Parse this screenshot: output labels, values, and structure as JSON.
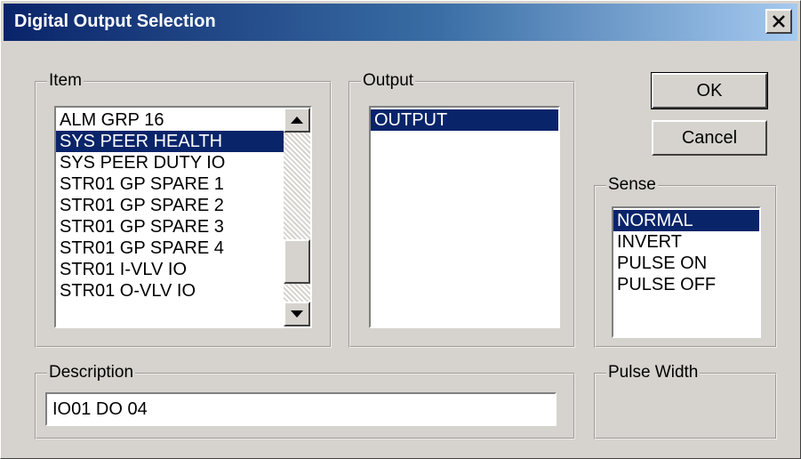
{
  "window": {
    "title": "Digital Output Selection",
    "close_glyph": "✕"
  },
  "item_group": {
    "label": "Item",
    "items": [
      {
        "label": "ALM GRP 16",
        "selected": false
      },
      {
        "label": "SYS PEER HEALTH",
        "selected": true
      },
      {
        "label": "SYS PEER DUTY IO",
        "selected": false
      },
      {
        "label": "STR01 GP SPARE 1",
        "selected": false
      },
      {
        "label": "STR01 GP SPARE 2",
        "selected": false
      },
      {
        "label": "STR01 GP SPARE 3",
        "selected": false
      },
      {
        "label": "STR01 GP SPARE 4",
        "selected": false
      },
      {
        "label": "STR01 I-VLV IO",
        "selected": false
      },
      {
        "label": "STR01 O-VLV IO",
        "selected": false
      }
    ],
    "scroll_up_icon": "scroll-up-arrow",
    "scroll_down_icon": "scroll-down-arrow"
  },
  "output_group": {
    "label": "Output",
    "items": [
      {
        "label": "OUTPUT",
        "selected": true
      }
    ]
  },
  "buttons": {
    "ok_label": "OK",
    "cancel_label": "Cancel"
  },
  "sense_group": {
    "label": "Sense",
    "items": [
      {
        "label": "NORMAL",
        "selected": true
      },
      {
        "label": "INVERT",
        "selected": false
      },
      {
        "label": "PULSE ON",
        "selected": false
      },
      {
        "label": "PULSE OFF",
        "selected": false
      }
    ]
  },
  "description_group": {
    "label": "Description",
    "value": "IO01 DO 04"
  },
  "pulse_width_group": {
    "label": "Pulse Width"
  },
  "colors": {
    "face": "#d6d3ce",
    "selection": "#0a246a",
    "title_start": "#0a246a",
    "title_end": "#a6caf0"
  }
}
